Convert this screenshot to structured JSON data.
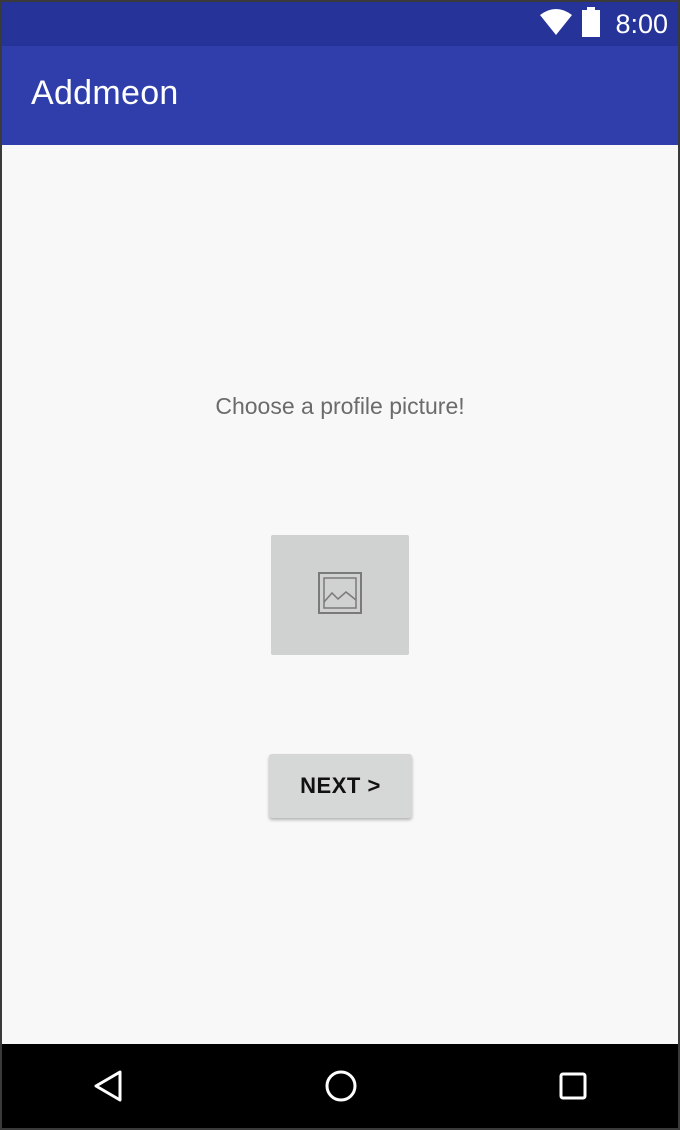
{
  "status_bar": {
    "time": "8:00",
    "icons": [
      "wifi-icon",
      "battery-icon"
    ]
  },
  "app_bar": {
    "title": "Addmeon"
  },
  "main": {
    "prompt": "Choose a profile picture!",
    "image_picker_icon": "image-placeholder-icon",
    "next_label": "NEXT >"
  },
  "nav_bar": {
    "buttons": [
      "back-icon",
      "home-icon",
      "recents-icon"
    ]
  },
  "colors": {
    "status_bar": "#26349a",
    "app_bar": "#2f3eaa",
    "background": "#f8f8f8",
    "prompt_text": "#6b6b6b",
    "picker_bg": "#d0d1d1",
    "button_bg": "#d6d7d7",
    "nav_bar": "#000000"
  }
}
